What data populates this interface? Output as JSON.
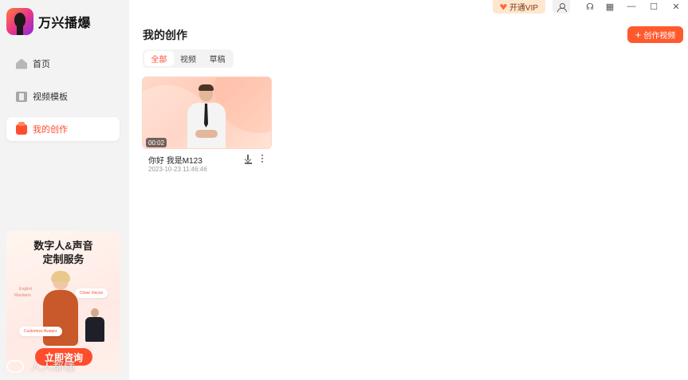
{
  "app": {
    "name": "万兴播爆"
  },
  "sidebar": {
    "items": [
      {
        "label": "首页",
        "icon": "home-icon",
        "active": false
      },
      {
        "label": "视频模板",
        "icon": "template-icon",
        "active": false
      },
      {
        "label": "我的创作",
        "icon": "my-creation-icon",
        "active": true
      }
    ]
  },
  "promo": {
    "title_line1": "数字人&声音",
    "title_line2": "定制服务",
    "tag_clone": "Clone Voices",
    "tag_avatar": "Customize Avatars",
    "lang_1": "English",
    "lang_2": "Mandarin",
    "button_label": "立即咨询"
  },
  "watermark": {
    "text": "人人都懂"
  },
  "topbar": {
    "vip_label": "开通VIP",
    "icons": [
      "user-icon",
      "headset-icon",
      "grid-icon",
      "minimize-icon",
      "maximize-icon",
      "close-icon"
    ],
    "glyphs": {
      "headset": "☊",
      "grid": "▦",
      "minimize": "—",
      "maximize": "☐",
      "close": "✕"
    }
  },
  "main": {
    "title": "我的创作",
    "tabs": [
      {
        "label": "全部",
        "active": true
      },
      {
        "label": "视频",
        "active": false
      },
      {
        "label": "草稿",
        "active": false
      }
    ],
    "create_button": {
      "plus": "+",
      "label": "创作视频"
    },
    "videos": [
      {
        "title": "你好 我是M123",
        "date": "2023-10-23 11:46:46",
        "duration": "00:02"
      }
    ]
  },
  "colors": {
    "accent": "#ff4d2d",
    "sidebar_bg": "#f3f3f3",
    "vip_bg": "#ffe6cf"
  }
}
